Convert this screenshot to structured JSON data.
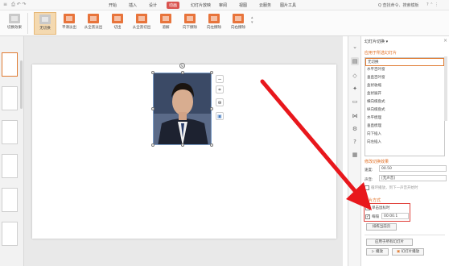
{
  "menu": {
    "items": [
      "开始",
      "插入",
      "设计",
      "动画",
      "幻灯片放映",
      "审阅",
      "视图",
      "云服务",
      "图片工具"
    ],
    "active": "动画",
    "search_placeholder": "Q 查找命令、搜索模板",
    "help": "?",
    "right_icons": "? ⌃ ⋮"
  },
  "ribbon": {
    "first_label": "切换效果",
    "buttons": [
      "无切换",
      "平滑淡出",
      "从全黑淡出",
      "切出",
      "从全黑切出",
      "溶解",
      "向下擦除",
      "向左擦除",
      "向右擦除"
    ],
    "selected": "无切换"
  },
  "task_pane": {
    "title": "幻灯片切换 ▾",
    "apply_section": "应用于所选幻灯片",
    "transitions": [
      "无切换",
      "水平百叶窗",
      "垂直百叶窗",
      "盒状收缩",
      "盒状展开",
      "横向棋盘式",
      "纵向棋盘式",
      "水平梳理",
      "垂直梳理",
      "向下插入",
      "向左插入"
    ],
    "selected_transition": "无切换",
    "modify_section": "修改切换效果",
    "speed_label": "速度:",
    "speed_value": "00.50",
    "sound_label": "声音:",
    "sound_value": "[无声音]",
    "loop_label": "循环播放，到下一声音开始时",
    "advance_section": "换片方式",
    "on_click_label": "单击鼠标时",
    "after_label": "每隔",
    "after_value": "00:00.1",
    "apply_master": "排练当前页",
    "apply_all": "应用于所有幻灯片",
    "play_button": "播放",
    "slideshow_button": "幻灯片播放"
  },
  "colors": {
    "accent": "#e07a30",
    "arrow": "#e8171c",
    "active_tab": "#d9534f"
  }
}
